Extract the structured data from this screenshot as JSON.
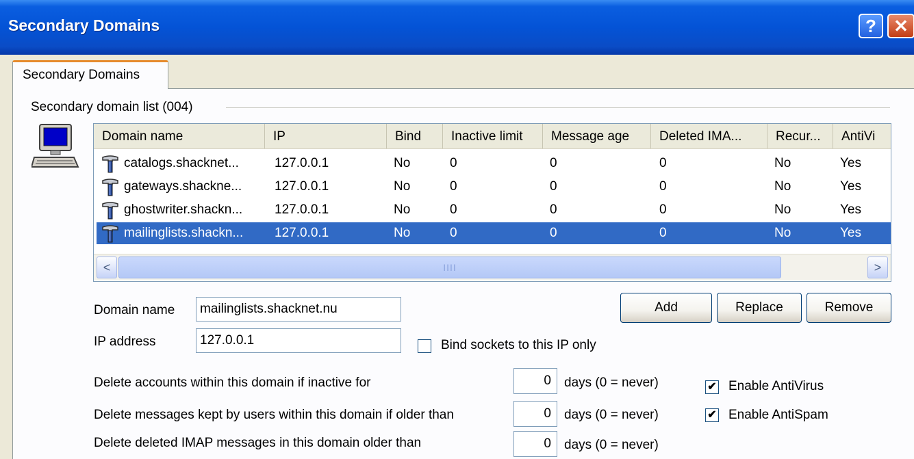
{
  "window": {
    "title": "Secondary Domains",
    "help_label": "?",
    "close_label": "✕"
  },
  "tab": {
    "label": "Secondary Domains"
  },
  "group": {
    "label": "Secondary domain list (004)"
  },
  "columns": [
    "Domain name",
    "IP",
    "Bind",
    "Inactive limit",
    "Message age",
    "Deleted IMA...",
    "Recur...",
    "AntiVi"
  ],
  "rows": [
    {
      "domain": "catalogs.shacknet...",
      "ip": "127.0.0.1",
      "bind": "No",
      "inactive": "0",
      "msg_age": "0",
      "deleted": "0",
      "recur": "No",
      "antivirus": "Yes"
    },
    {
      "domain": "gateways.shackne...",
      "ip": "127.0.0.1",
      "bind": "No",
      "inactive": "0",
      "msg_age": "0",
      "deleted": "0",
      "recur": "No",
      "antivirus": "Yes"
    },
    {
      "domain": "ghostwriter.shackn...",
      "ip": "127.0.0.1",
      "bind": "No",
      "inactive": "0",
      "msg_age": "0",
      "deleted": "0",
      "recur": "No",
      "antivirus": "Yes"
    },
    {
      "domain": "mailinglists.shackn...",
      "ip": "127.0.0.1",
      "bind": "No",
      "inactive": "0",
      "msg_age": "0",
      "deleted": "0",
      "recur": "No",
      "antivirus": "Yes"
    }
  ],
  "selected_row": 3,
  "scrollbar": {
    "left_arrow": "<",
    "right_arrow": ">",
    "grip": "IIII"
  },
  "form": {
    "domain_label": "Domain name",
    "domain_value": "mailinglists.shacknet.nu",
    "ip_label": "IP address",
    "ip_value": "127.0.0.1",
    "bind_label": "Bind sockets to this IP only",
    "bind_checked": false
  },
  "buttons": {
    "add": "Add",
    "replace": "Replace",
    "remove": "Remove"
  },
  "settings": {
    "inactive_label": "Delete accounts within this domain if inactive for",
    "inactive_value": "0",
    "msg_label": "Delete messages kept by users within this domain if older than",
    "msg_value": "0",
    "imap_label": "Delete deleted IMAP messages in this domain older than",
    "imap_value": "0",
    "days_note": "days (0 = never)",
    "antivirus_label": "Enable AntiVirus",
    "antivirus_checked": true,
    "antispam_label": "Enable AntiSpam",
    "antispam_checked": true,
    "check_mark": "✔"
  },
  "colors": {
    "selection": "#316ac5",
    "title_bar": "#0453d6",
    "dialog_bg": "#ece9d8"
  }
}
